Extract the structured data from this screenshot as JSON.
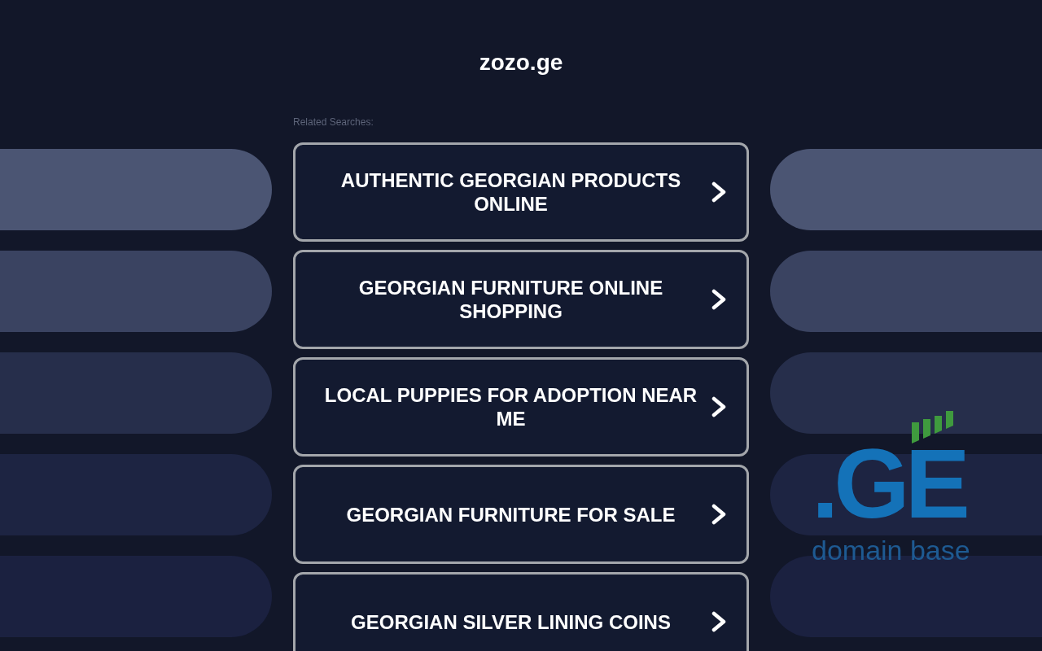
{
  "site_title": "zozo.ge",
  "related_searches": {
    "label": "Related Searches:",
    "items": [
      {
        "text": "AUTHENTIC GEORGIAN PRODUCTS ONLINE"
      },
      {
        "text": "GEORGIAN FURNITURE ONLINE SHOPPING"
      },
      {
        "text": "LOCAL PUPPIES FOR ADOPTION NEAR ME"
      },
      {
        "text": "GEORGIAN FURNITURE FOR SALE"
      },
      {
        "text": "GEORGIAN SILVER LINING COINS"
      }
    ]
  },
  "logo": {
    "mark": ".GE",
    "tagline": "domain base"
  }
}
